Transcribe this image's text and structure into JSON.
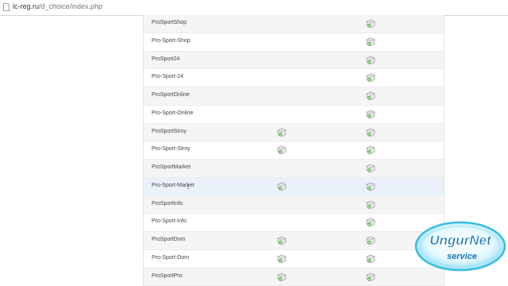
{
  "browser": {
    "url_host": "lc-reg.ru",
    "url_path": "/d_choice/index.php"
  },
  "rows": [
    {
      "name": "ProSportShop",
      "col1": false,
      "col2": true
    },
    {
      "name": "Pro-Sport-Shop",
      "col1": false,
      "col2": true
    },
    {
      "name": "ProSport24",
      "col1": false,
      "col2": true
    },
    {
      "name": "Pro-Sport-24",
      "col1": false,
      "col2": true
    },
    {
      "name": "ProSportOnline",
      "col1": false,
      "col2": true
    },
    {
      "name": "Pro-Sport-Online",
      "col1": false,
      "col2": true
    },
    {
      "name": "ProSportStroy",
      "col1": true,
      "col2": true
    },
    {
      "name": "Pro-Sport-Stroy",
      "col1": true,
      "col2": true
    },
    {
      "name": "ProSportMarket",
      "col1": false,
      "col2": true
    },
    {
      "name": "Pro-Sport-Market",
      "col1": true,
      "col2": true,
      "hover": true
    },
    {
      "name": "ProSportInfo",
      "col1": false,
      "col2": true
    },
    {
      "name": "Pro-Sport-Info",
      "col1": false,
      "col2": true
    },
    {
      "name": "ProSportDom",
      "col1": true,
      "col2": true
    },
    {
      "name": "Pro-Sport-Dom",
      "col1": true,
      "col2": true
    },
    {
      "name": "ProSportPro",
      "col1": true,
      "col2": true
    }
  ],
  "icons": {
    "add": "add-domain-icon"
  },
  "watermark": {
    "line1": "UngurNet",
    "line2": "service"
  },
  "colors": {
    "hover_row": "#eaf1fb",
    "alt_row": "#f5f5f5",
    "icon_green": "#3a9a2a"
  }
}
